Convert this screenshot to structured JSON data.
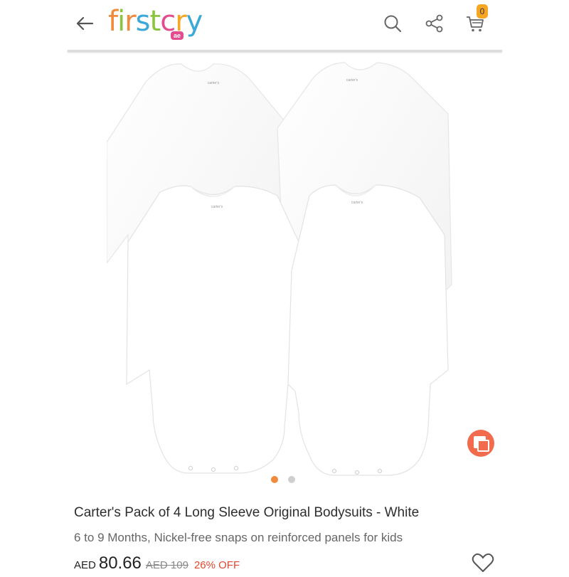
{
  "header": {
    "logo": {
      "main": "firstcry",
      "badge": "ae"
    },
    "icons": [
      "back-arrow-icon",
      "search-icon",
      "share-icon",
      "cart-icon"
    ],
    "cart_count": "0"
  },
  "product_image": {
    "brand_tag": "carter's",
    "carousel": {
      "total_images": 2,
      "active_index": 1
    }
  },
  "product": {
    "title": "Carter's Pack of 4 Long Sleeve Original Bodysuits - White",
    "subtitle": "6 to 9 Months, Nickel-free snaps on reinforced panels for kids",
    "currency": "AED",
    "price": "80.66",
    "old_price": "AED 109",
    "discount": "26% OFF"
  },
  "colors": {
    "accent_orange": "#f08a3c",
    "zoom_button": "#f26b4d",
    "discount_red": "#e4472f",
    "cart_badge": "#f5a623"
  }
}
